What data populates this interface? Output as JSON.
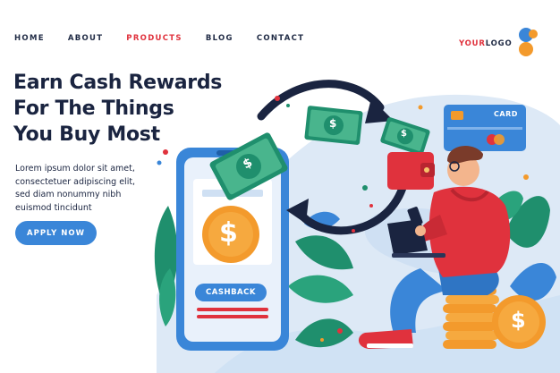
{
  "nav": {
    "items": [
      {
        "label": "HOME"
      },
      {
        "label": "ABOUT"
      },
      {
        "label": "PRODUCTS"
      },
      {
        "label": "BLOG"
      },
      {
        "label": "CONTACT"
      }
    ]
  },
  "logo": {
    "part1": "YOUR",
    "part2": "LOGO"
  },
  "hero": {
    "headline_line1": "Earn Cash Rewards",
    "headline_line2": "For The Things",
    "headline_line3": "You Buy Most",
    "body_line1": "Lorem ipsum dolor sit amet,",
    "body_line2": "consectetuer adipiscing elit,",
    "body_line3": "sed diam nonummy nibh",
    "body_line4": "euismod tincidunt",
    "cta_label": "APPLY NOW"
  },
  "illustration": {
    "phone_button_label": "CASHBACK",
    "card_label": "CARD",
    "currency_symbol": "$"
  },
  "colors": {
    "accent_red": "#e0323d",
    "accent_blue": "#3a86d8",
    "accent_orange": "#f39a2c",
    "navy": "#1a2440"
  }
}
